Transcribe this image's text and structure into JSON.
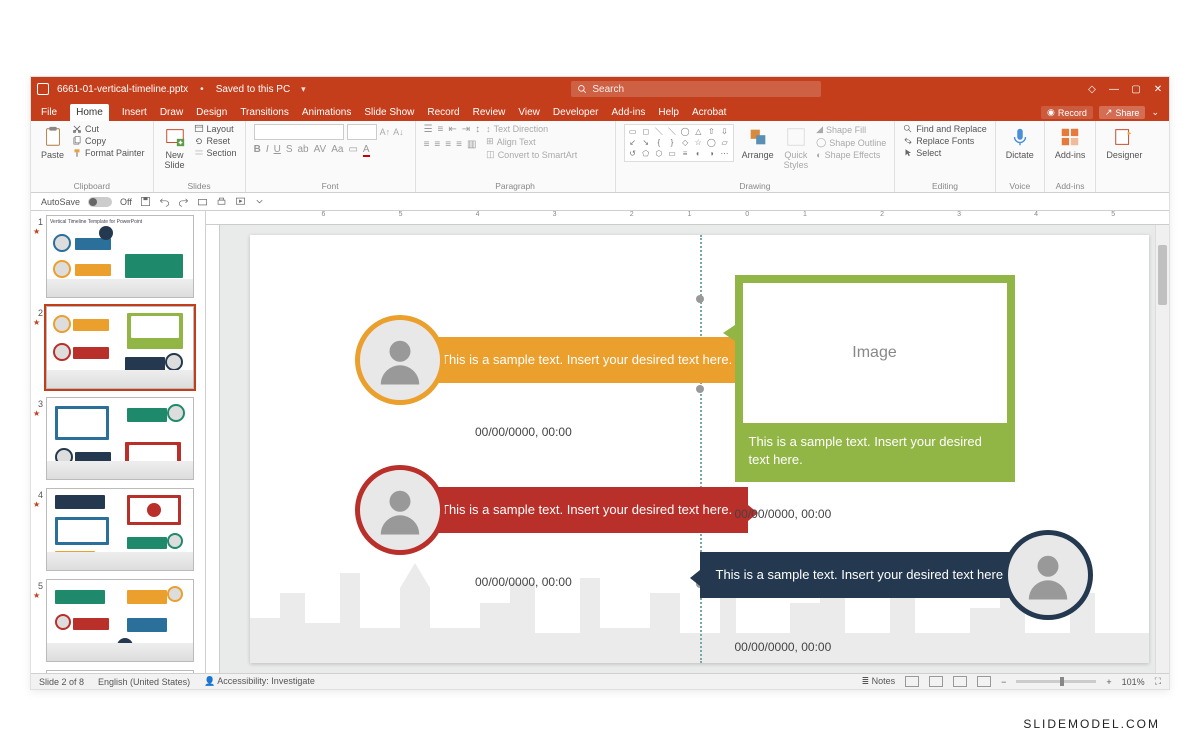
{
  "watermark": "SLIDEMODEL.COM",
  "title": {
    "filename": "6661-01-vertical-timeline.pptx",
    "savestate": "Saved to this PC"
  },
  "search": {
    "placeholder": "Search"
  },
  "menu": {
    "items": [
      "File",
      "Home",
      "Insert",
      "Draw",
      "Design",
      "Transitions",
      "Animations",
      "Slide Show",
      "Record",
      "Review",
      "View",
      "Developer",
      "Add-ins",
      "Help",
      "Acrobat"
    ],
    "active": "Home",
    "record": "Record",
    "share": "Share"
  },
  "ribbon": {
    "clipboard": {
      "label": "Clipboard",
      "paste": "Paste",
      "cut": "Cut",
      "copy": "Copy",
      "fmt": "Format Painter"
    },
    "slides": {
      "label": "Slides",
      "new": "New\nSlide",
      "layout": "Layout",
      "reset": "Reset",
      "section": "Section"
    },
    "font": {
      "label": "Font"
    },
    "paragraph": {
      "label": "Paragraph",
      "textdir": "Text Direction",
      "align": "Align Text",
      "smart": "Convert to SmartArt"
    },
    "drawing": {
      "label": "Drawing",
      "arrange": "Arrange",
      "quick": "Quick\nStyles",
      "sfill": "Shape Fill",
      "soutline": "Shape Outline",
      "seffects": "Shape Effects"
    },
    "editing": {
      "label": "Editing",
      "find": "Find and Replace",
      "replace": "Replace Fonts",
      "select": "Select"
    },
    "voice": {
      "label": "Voice",
      "dictate": "Dictate"
    },
    "addins": {
      "label": "Add-ins",
      "btn": "Add-ins"
    },
    "designer": {
      "label": "",
      "btn": "Designer"
    }
  },
  "qat": {
    "autosave": "AutoSave",
    "off": "Off"
  },
  "status": {
    "slide": "Slide 2 of 8",
    "lang": "English (United States)",
    "access": "Accessibility: Investigate",
    "notes": "Notes",
    "zoom": "101%"
  },
  "thumbs": {
    "count": 6,
    "selected": 2,
    "t1title": "Vertical Timeline Template for PowerPoint"
  },
  "slide": {
    "sample": "This is a sample text. Insert your desired text here.",
    "date": "00/00/0000, 00:00",
    "imgph": "Image"
  }
}
